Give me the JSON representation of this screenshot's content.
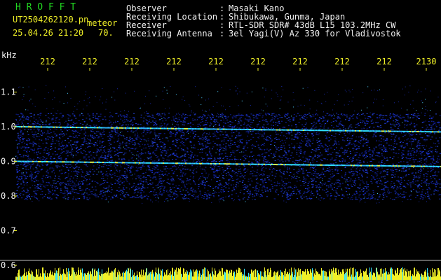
{
  "header": {
    "app_name": "H R O F F T",
    "filename": "UT2504262120.pn",
    "event_tag": "meteor",
    "datetime": "25.04.26 21:20",
    "count": "70.",
    "info_labels": [
      "Observer",
      "Receiving Location",
      "Receiver",
      "Receiving Antenna"
    ],
    "info_colons": [
      ":",
      ":",
      ":",
      ":"
    ],
    "info_values": [
      "Masaki Kano",
      "Shibukawa, Gunma, Japan",
      "RTL-SDR SDR# 43dB L15 103.2MHz CW",
      "3el Yagi(V) Az 330 for Vladivostok"
    ]
  },
  "colors": {
    "header_green": "#22d822",
    "label_yellow": "#f0f028",
    "text_white": "#f2f2f2",
    "spectrum_background": "#000000",
    "noise_blue": "#1a2fc8",
    "echo_cyan": "#30e0ff"
  },
  "chart_data": {
    "type": "heatmap",
    "ylabel": "kHz",
    "ylim": [
      0.6,
      1.15
    ],
    "yticks": [
      "1.1",
      "1.0",
      "0.9",
      "0.8",
      "0.7",
      "0.6"
    ],
    "ytick_values": [
      1.1,
      1.0,
      0.9,
      0.8,
      0.7,
      0.6
    ],
    "xticks": [
      "212",
      "212",
      "212",
      "212",
      "212",
      "212",
      "212",
      "212",
      "212",
      "2130"
    ],
    "noise_band": [
      0.79,
      1.04
    ],
    "signal_lines": [
      {
        "name": "",
        "y_start": 1.0,
        "y_end": 0.985
      },
      {
        "name": "",
        "y_start": 0.9,
        "y_end": 0.885
      }
    ]
  }
}
